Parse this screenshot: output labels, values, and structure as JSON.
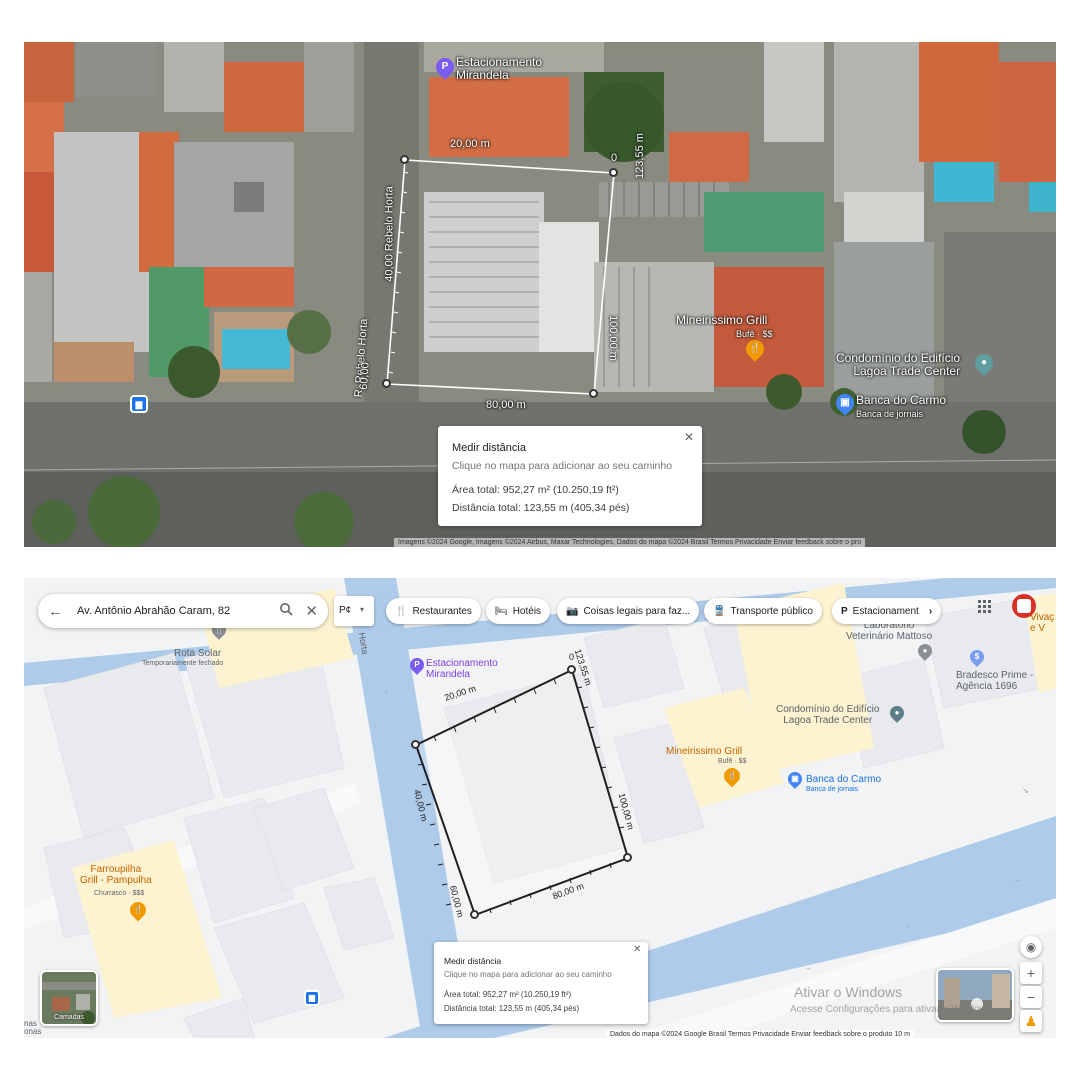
{
  "satellite": {
    "labels": {
      "parking": "Estacionamento\nMirandela",
      "restaurant": "Mineirissimo Grill",
      "restaurant_sub": "Bufê · $$",
      "condo": "Condomínio do Edifício\nLagoa Trade Center",
      "bank": "Banca do Carmo",
      "bank_sub": "Banca de jornais",
      "street_v": "40,00 Rebelo Horta",
      "street_r": "R. Rebelo Horta",
      "street_r_num": "60,00"
    },
    "measures": {
      "top": "20,00 m",
      "right_top": "123,55 m",
      "right": "100,00 m",
      "bottom": "80,00 m",
      "zero": "0"
    },
    "panel": {
      "title": "Medir distância",
      "hint": "Clique no mapa para adicionar ao seu caminho",
      "area": "Área total: 952,27 m² (10.250,19 ft²)",
      "distance": "Distância total: 123,55 m (405,34 pés)",
      "close": "✕"
    },
    "attribution": "Imagens ©2024 Google, Imagens ©2024 Airbus, Maxar Technologies, Dados do mapa ©2024     Brasil    Termos    Privacidade    Enviar feedback sobre o pro"
  },
  "roadmap": {
    "search": {
      "back": "←",
      "query": "Av. Antônio Abrahão Caram, 82",
      "search_icon": "🔍",
      "clear": "✕"
    },
    "layers_toggle": "P¢",
    "chips": [
      {
        "icon": "🍴",
        "label": "Restaurantes"
      },
      {
        "icon": "🛏",
        "label": "Hotéis"
      },
      {
        "icon": "📷",
        "label": "Coisas legais para faz..."
      },
      {
        "icon": "🚆",
        "label": "Transporte público"
      },
      {
        "icon": "P",
        "label": "Estacionament"
      }
    ],
    "chip_more": "›",
    "apps_icon": "⋮⋮⋮",
    "labels": {
      "rota": "Rota Solar",
      "rota_sub": "Temporariamente fechado",
      "parking": "Estacionamento\nMirandela",
      "vet": "Laboratório\nVeterinário Mattoso",
      "bradesco": "Bradesco Prime -\nAgência 1696",
      "vivac": "Vivaç\ne V",
      "condo": "Condomínio do Edifício\nLagoa Trade Center",
      "mineir": "Mineirissimo Grill",
      "mineir_sub": "Bufê · $$",
      "bank": "Banca do Carmo",
      "bank_sub": "Banca de jornais",
      "farrou": "Farroupilha\nGrill - Pampulha",
      "farrou_sub": "Churrasco · $$$",
      "street": "Horta",
      "left_edge": "nas\nonas"
    },
    "measures": {
      "top": "20,00 m",
      "right_top": "123,55 m",
      "right": "100,00 m",
      "bottom": "80,00 m",
      "left": "40,00 m",
      "left_bottom": "60,00 m",
      "zero": "0"
    },
    "panel": {
      "title": "Medir distância",
      "hint": "Clique no mapa para adicionar ao seu caminho",
      "area": "Área total: 952,27 m² (10.250,19 ft²)",
      "distance": "Distância total: 123,55 m (405,34 pés)",
      "close": "✕"
    },
    "layers_button": "Camadas",
    "watermark_title": "Ativar o Windows",
    "watermark_sub": "Acesse Configurações para ativar o Windows.",
    "attribution": "Dados do mapa ©2024 Google    Brasil    Termos    Privacidade    Enviar feedback sobre o produto    10 m",
    "zoom_in": "+",
    "zoom_out": "−",
    "locate_icon": "◉",
    "pegman_icon": "♟"
  }
}
